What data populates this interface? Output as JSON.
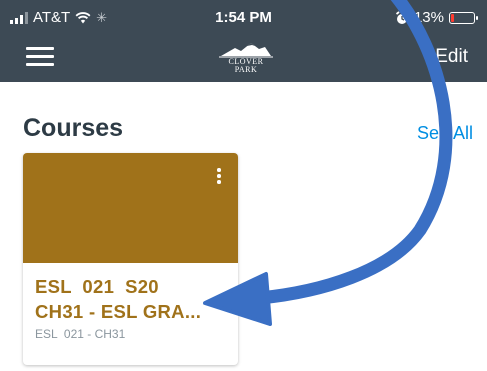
{
  "status_bar": {
    "carrier": "AT&T",
    "time": "1:54 PM",
    "battery": "13%",
    "battery_level": 0.13
  },
  "nav": {
    "logo_text_line1": "CLOVER PARK",
    "edit_label": "Edit"
  },
  "colors": {
    "nav_background": "#3d4a55",
    "course_color": "#a0721a",
    "link_color": "#008ee2",
    "annotation_arrow": "#3a6fc4"
  },
  "courses": {
    "title": "Courses",
    "see_all_label": "See All",
    "items": [
      {
        "name": "ESL  021  S20\nCH31 - ESL GRA...",
        "code": "ESL  021 - CH31"
      }
    ]
  },
  "icons": {
    "menu": "hamburger-menu-icon",
    "more": "more-vertical-icon",
    "wifi": "wifi-icon",
    "alarm": "alarm-icon",
    "battery": "battery-icon",
    "logo": "mountain-logo-icon"
  }
}
